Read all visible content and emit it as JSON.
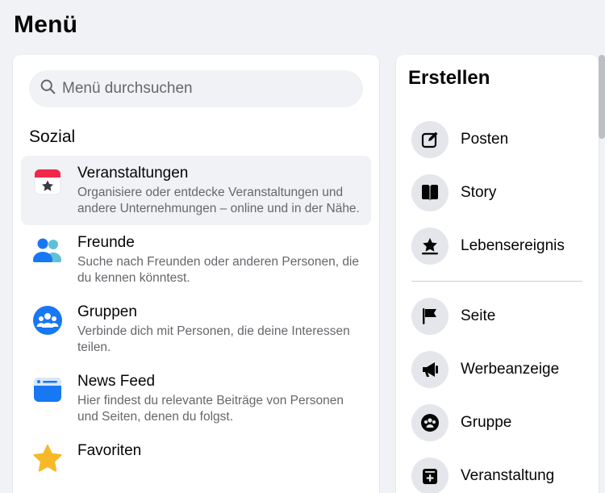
{
  "page": {
    "title": "Menü"
  },
  "search": {
    "placeholder": "Menü durchsuchen"
  },
  "social": {
    "heading": "Sozial",
    "items": [
      {
        "title": "Veranstaltungen",
        "desc": "Organisiere oder entdecke Veranstaltungen und andere Unternehmungen – online und in der Nähe.",
        "icon": "calendar-star-icon"
      },
      {
        "title": "Freunde",
        "desc": "Suche nach Freunden oder anderen Personen, die du kennen könntest.",
        "icon": "friends-icon"
      },
      {
        "title": "Gruppen",
        "desc": "Verbinde dich mit Personen, die deine Interessen teilen.",
        "icon": "groups-icon"
      },
      {
        "title": "News Feed",
        "desc": "Hier findest du relevante Beiträge von Personen und Seiten, denen du folgst.",
        "icon": "news-feed-icon"
      },
      {
        "title": "Favoriten",
        "desc": "",
        "icon": "star-icon"
      }
    ]
  },
  "create": {
    "title": "Erstellen",
    "items": [
      {
        "label": "Posten",
        "icon": "compose-icon"
      },
      {
        "label": "Story",
        "icon": "book-icon"
      },
      {
        "label": "Lebensereignis",
        "icon": "life-event-star-icon"
      },
      {
        "label": "Seite",
        "icon": "flag-icon"
      },
      {
        "label": "Werbeanzeige",
        "icon": "megaphone-icon"
      },
      {
        "label": "Gruppe",
        "icon": "group-circle-icon"
      },
      {
        "label": "Veranstaltung",
        "icon": "calendar-plus-icon"
      }
    ]
  },
  "colors": {
    "accent": "#1877f2",
    "background": "#f0f2f5",
    "secondary_text": "#65676b",
    "event_red": "#f02849",
    "favorite_yellow": "#f7b928"
  }
}
